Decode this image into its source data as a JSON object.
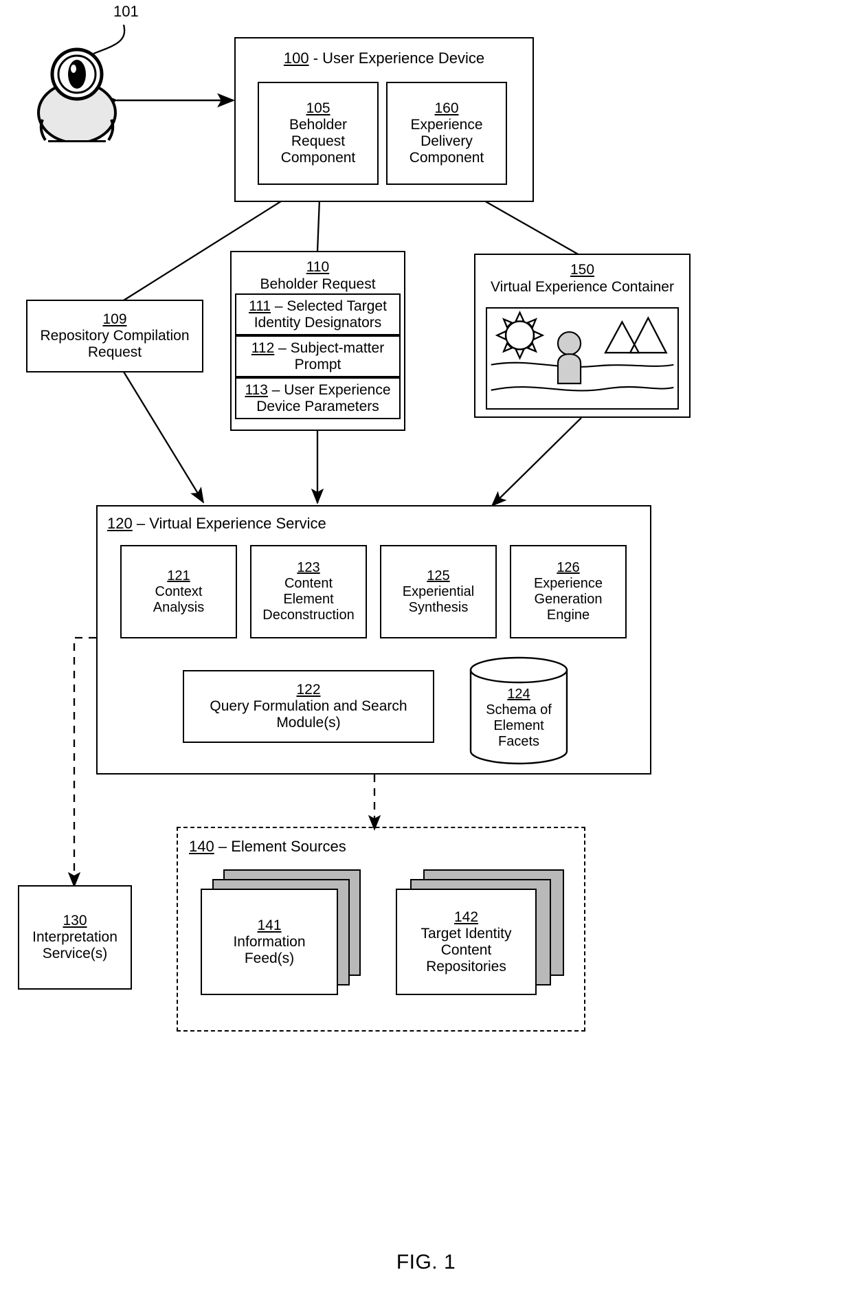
{
  "figure": {
    "caption": "FIG. 1"
  },
  "actor": {
    "ref": "101",
    "name": "beholder-user-icon"
  },
  "device": {
    "ref": "100",
    "sep": " - ",
    "title": "User Experience Device",
    "components": [
      {
        "ref": "105",
        "lines": [
          "Beholder",
          "Request",
          "Component"
        ]
      },
      {
        "ref": "160",
        "lines": [
          "Experience",
          "Delivery",
          "Component"
        ]
      }
    ]
  },
  "repository_request": {
    "ref": "109",
    "lines": [
      "Repository Compilation",
      "Request"
    ]
  },
  "beholder_request": {
    "ref": "110",
    "title": "Beholder Request",
    "fields": [
      {
        "ref": "111",
        "sep": " – ",
        "lines": [
          "Selected Target",
          "Identity Designators"
        ]
      },
      {
        "ref": "112",
        "sep": " – ",
        "lines": [
          "Subject-matter",
          "Prompt"
        ]
      },
      {
        "ref": "113",
        "sep": " – ",
        "lines": [
          "User Experience",
          "Device Parameters"
        ]
      }
    ]
  },
  "container": {
    "ref": "150",
    "title": "Virtual Experience Container",
    "scene": {
      "sun": "sun-icon",
      "figure": "avatar-figure-icon",
      "mountains": "mountains-icon",
      "ground": "landscape-horizon"
    }
  },
  "service": {
    "ref": "120",
    "sep": " – ",
    "title": "Virtual Experience Service",
    "modules": [
      {
        "ref": "121",
        "lines": [
          "Context",
          "Analysis"
        ]
      },
      {
        "ref": "123",
        "lines": [
          "Content",
          "Element",
          "Deconstruction"
        ]
      },
      {
        "ref": "125",
        "lines": [
          "Experiential",
          "Synthesis"
        ]
      },
      {
        "ref": "126",
        "lines": [
          "Experience",
          "Generation",
          "Engine"
        ]
      }
    ],
    "query_module": {
      "ref": "122",
      "lines": [
        "Query Formulation and Search",
        "Module(s)"
      ]
    },
    "schema": {
      "ref": "124",
      "lines": [
        "Schema of",
        "Element",
        "Facets"
      ]
    }
  },
  "interpretation": {
    "ref": "130",
    "lines": [
      "Interpretation",
      "Service(s)"
    ]
  },
  "element_sources": {
    "ref": "140",
    "sep": " – ",
    "title": "Element Sources",
    "stacks": [
      {
        "ref": "141",
        "lines": [
          "Information",
          "Feed(s)"
        ]
      },
      {
        "ref": "142",
        "lines": [
          "Target Identity",
          "Content",
          "Repositories"
        ]
      }
    ]
  },
  "colors": {
    "ink": "#000000",
    "paper": "#ffffff",
    "sheet_shadow": "#b9b9b9",
    "scene_fill": "#cfcfcf"
  }
}
